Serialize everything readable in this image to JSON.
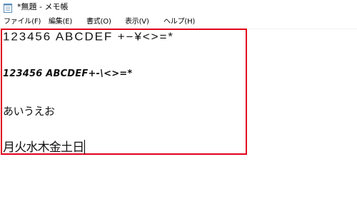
{
  "window": {
    "title": "*無題 - メモ帳",
    "icon": "notepad-icon"
  },
  "menubar": {
    "items": [
      {
        "label": "ファイル(F)"
      },
      {
        "label": "編集(E)"
      },
      {
        "label": "書式(O)"
      },
      {
        "label": "表示(V)"
      },
      {
        "label": "ヘルプ(H)"
      }
    ]
  },
  "editor": {
    "lines": [
      "123456 ABCDEF +−¥<>=*",
      "123456 ABCDEF+-\\<>=*",
      "あいうえお",
      "月火水木金土日"
    ]
  },
  "colors": {
    "highlight_border": "#e0001b",
    "background": "#ffffff"
  }
}
